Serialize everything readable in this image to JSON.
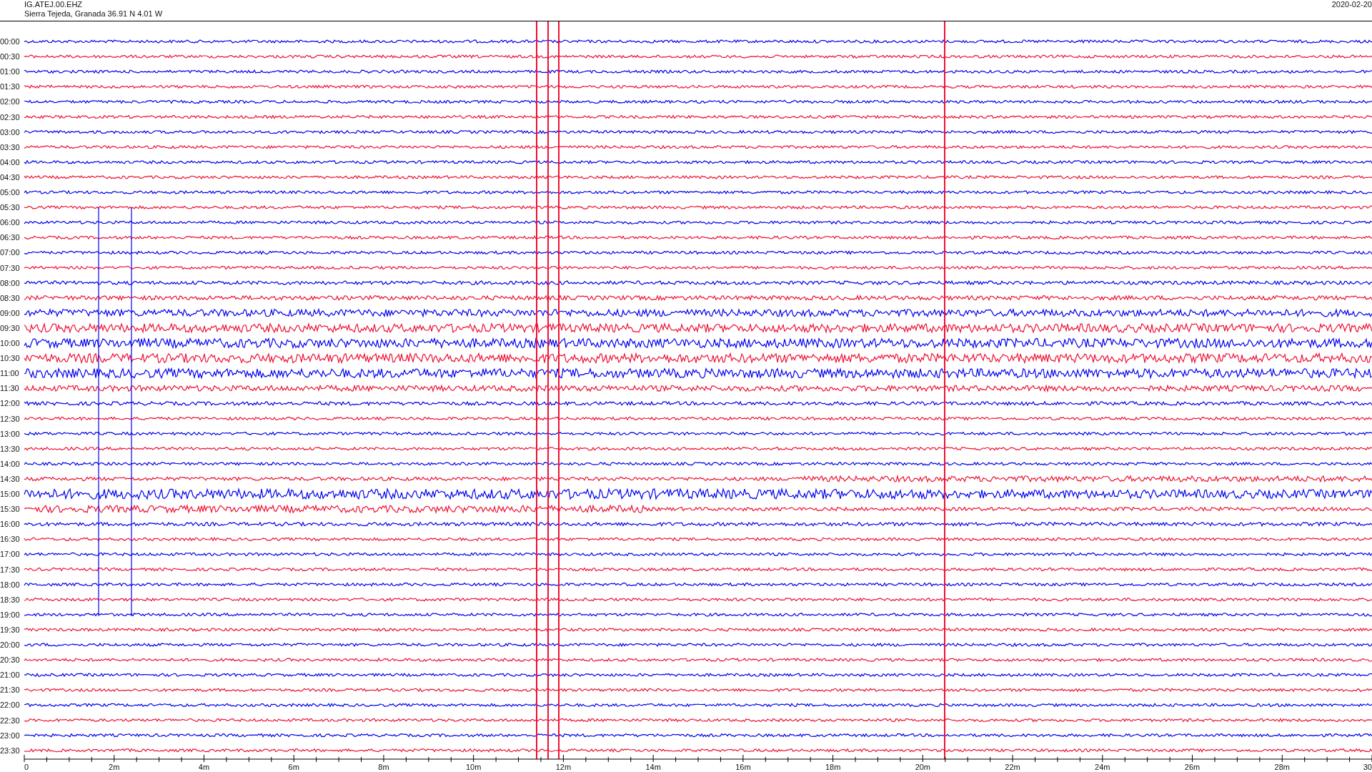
{
  "header": {
    "station": "IG.ATEJ.00.EHZ",
    "location": "Sierra Tejeda, Granada  36.91 N 4.01 W",
    "date": "2020-02-20"
  },
  "rows": [
    {
      "time": "00:00",
      "color": "#0000ee"
    },
    {
      "time": "00:30",
      "color": "#ee1133"
    },
    {
      "time": "01:00",
      "color": "#0000ee"
    },
    {
      "time": "01:30",
      "color": "#ee1133"
    },
    {
      "time": "02:00",
      "color": "#0000ee"
    },
    {
      "time": "02:30",
      "color": "#ee1133"
    },
    {
      "time": "03:00",
      "color": "#0000ee"
    },
    {
      "time": "03:30",
      "color": "#ee1133"
    },
    {
      "time": "04:00",
      "color": "#0000ee"
    },
    {
      "time": "04:30",
      "color": "#ee1133"
    },
    {
      "time": "05:00",
      "color": "#0000ee"
    },
    {
      "time": "05:30",
      "color": "#ee1133"
    },
    {
      "time": "06:00",
      "color": "#0000ee"
    },
    {
      "time": "06:30",
      "color": "#ee1133"
    },
    {
      "time": "07:00",
      "color": "#0000ee"
    },
    {
      "time": "07:30",
      "color": "#ee1133"
    },
    {
      "time": "08:00",
      "color": "#0000ee"
    },
    {
      "time": "08:30",
      "color": "#ee1133"
    },
    {
      "time": "09:00",
      "color": "#0000ee"
    },
    {
      "time": "09:30",
      "color": "#ee1133"
    },
    {
      "time": "10:00",
      "color": "#0000ee"
    },
    {
      "time": "10:30",
      "color": "#ee1133"
    },
    {
      "time": "11:00",
      "color": "#0000ee"
    },
    {
      "time": "11:30",
      "color": "#ee1133"
    },
    {
      "time": "12:00",
      "color": "#0000ee"
    },
    {
      "time": "12:30",
      "color": "#ee1133"
    },
    {
      "time": "13:00",
      "color": "#0000ee"
    },
    {
      "time": "13:30",
      "color": "#ee1133"
    },
    {
      "time": "14:00",
      "color": "#0000ee"
    },
    {
      "time": "14:30",
      "color": "#ee1133"
    },
    {
      "time": "15:00",
      "color": "#0000ee"
    },
    {
      "time": "15:30",
      "color": "#ee1133"
    },
    {
      "time": "16:00",
      "color": "#0000ee"
    },
    {
      "time": "16:30",
      "color": "#ee1133"
    },
    {
      "time": "17:00",
      "color": "#0000ee"
    },
    {
      "time": "17:30",
      "color": "#ee1133"
    },
    {
      "time": "18:00",
      "color": "#0000ee"
    },
    {
      "time": "18:30",
      "color": "#ee1133"
    },
    {
      "time": "19:00",
      "color": "#0000ee"
    },
    {
      "time": "19:30",
      "color": "#ee1133"
    },
    {
      "time": "20:00",
      "color": "#0000ee"
    },
    {
      "time": "20:30",
      "color": "#ee1133"
    },
    {
      "time": "21:00",
      "color": "#0000ee"
    },
    {
      "time": "21:30",
      "color": "#ee1133"
    },
    {
      "time": "22:00",
      "color": "#0000ee"
    },
    {
      "time": "22:30",
      "color": "#ee1133"
    },
    {
      "time": "23:00",
      "color": "#0000ee"
    },
    {
      "time": "23:30",
      "color": "#ee1133"
    }
  ],
  "x_axis": [
    "0",
    "2m",
    "4m",
    "6m",
    "8m",
    "10m",
    "12m",
    "14m",
    "16m",
    "18m",
    "20m",
    "22m",
    "24m",
    "26m",
    "28m",
    "30"
  ]
}
